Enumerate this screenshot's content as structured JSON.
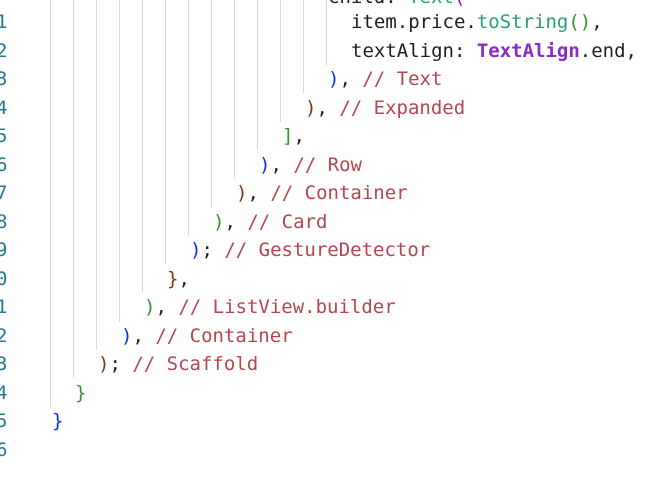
{
  "editor": {
    "line_numbers": [
      "1",
      "2",
      "3",
      "4",
      "5",
      "6",
      "7",
      "8",
      "9",
      "0",
      "1",
      "2",
      "3",
      "4",
      "5",
      "6"
    ],
    "lines": {
      "l0": {
        "a": "child: ",
        "b": "Text",
        "c": "("
      },
      "l1": {
        "a": "item.price.",
        "b": "toString",
        "c": "()",
        "d": ","
      },
      "l2": {
        "a": "textAlign: ",
        "b": "TextAlign",
        "c": ".end,"
      },
      "l3": {
        "a": ")",
        "b": ", ",
        "c": "// Text"
      },
      "l4": {
        "a": ")",
        "b": ", ",
        "c": "// Expanded"
      },
      "l5": {
        "a": "]",
        "b": ","
      },
      "l6": {
        "a": ")",
        "b": ", ",
        "c": "// Row"
      },
      "l7": {
        "a": ")",
        "b": ", ",
        "c": "// Container"
      },
      "l8": {
        "a": ")",
        "b": ", ",
        "c": "// Card"
      },
      "l9": {
        "a": ")",
        "b": "; ",
        "c": "// GestureDetector"
      },
      "l10": {
        "a": "}",
        "b": ","
      },
      "l11": {
        "a": ")",
        "b": ", ",
        "c": "// ListView.builder"
      },
      "l12": {
        "a": ")",
        "b": ", ",
        "c": "// Container"
      },
      "l13": {
        "a": ")",
        "b": "; ",
        "c": "// Scaffold"
      },
      "l14": {
        "a": "}"
      },
      "l15": {
        "a": "}"
      }
    }
  },
  "colors": {
    "background": "#ffffff",
    "line_number": "#237893",
    "bracket_blue": "#0431fa",
    "bracket_green": "#319331",
    "bracket_brown": "#7b3814",
    "comment": "#b5454f",
    "function": "#24a178",
    "class": "#8a2bc8",
    "indent_guide": "#d9d9d9"
  }
}
